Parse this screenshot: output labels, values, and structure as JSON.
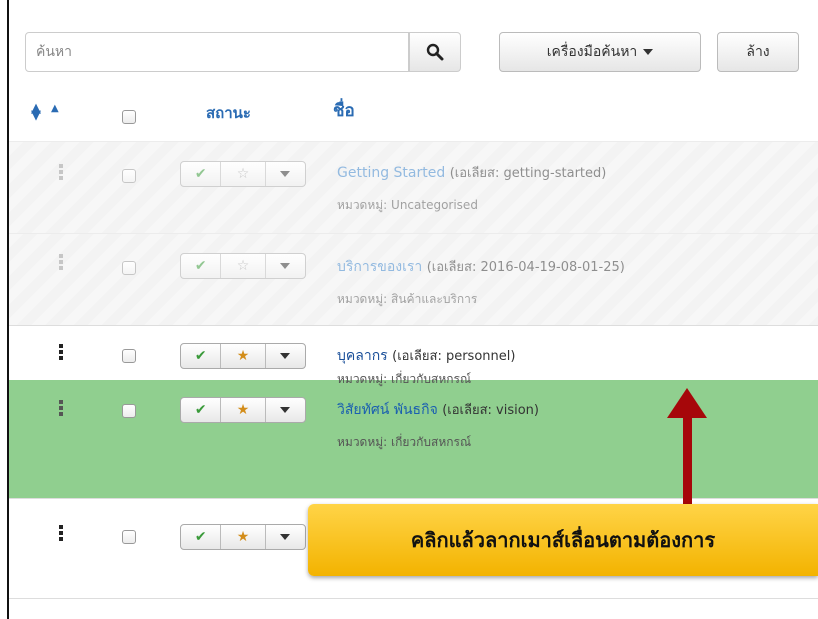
{
  "search": {
    "placeholder": "ค้นหา",
    "button_icon": "search-icon"
  },
  "toolbar": {
    "search_tools_label": "เครื่องมือค้นหา",
    "clear_label": "ล้าง"
  },
  "table_header": {
    "sort_icon": "sort-icon",
    "status_label": "สถานะ",
    "title_label": "ชื่อ"
  },
  "rows": [
    {
      "title": "Getting Started",
      "alias": "(เอเลียส: getting-started)",
      "category": "หมวดหมู่: Uncategorised",
      "published": true,
      "featured": false,
      "state": "unpublished"
    },
    {
      "title": "บริการของเรา",
      "alias": "(เอเลียส: 2016-04-19-08-01-25)",
      "category": "หมวดหมู่: สินค้าและบริการ",
      "published": true,
      "featured": false,
      "state": "unpublished"
    },
    {
      "title": "บุคลากร",
      "alias": "(เอเลียส: personnel)",
      "category": "หมวดหมู่: เกี่ยวกับสหกรณ์",
      "published": true,
      "featured": true,
      "state": "normal"
    },
    {
      "title": "วิสัยทัศน์ พันธกิจ",
      "alias": "(เอเลียส: vision)",
      "category": "หมวดหมู่: เกี่ยวกับสหกรณ์",
      "published": true,
      "featured": true,
      "state": "dragging"
    },
    {
      "title": "",
      "alias": "",
      "category": "",
      "published": true,
      "featured": true,
      "state": "normal"
    }
  ],
  "callout": {
    "text": "คลิกแล้วลากเมาส์เลื่อนตามต้องการ",
    "color": "#f5be1a"
  },
  "arrow": {
    "color": "#a6070a",
    "direction": "up"
  },
  "colors": {
    "link": "#1a4f99",
    "header": "#2a6bb3",
    "drag_row": "#90cf8f",
    "check": "#3a9a3a",
    "star": "#d38d1a"
  }
}
